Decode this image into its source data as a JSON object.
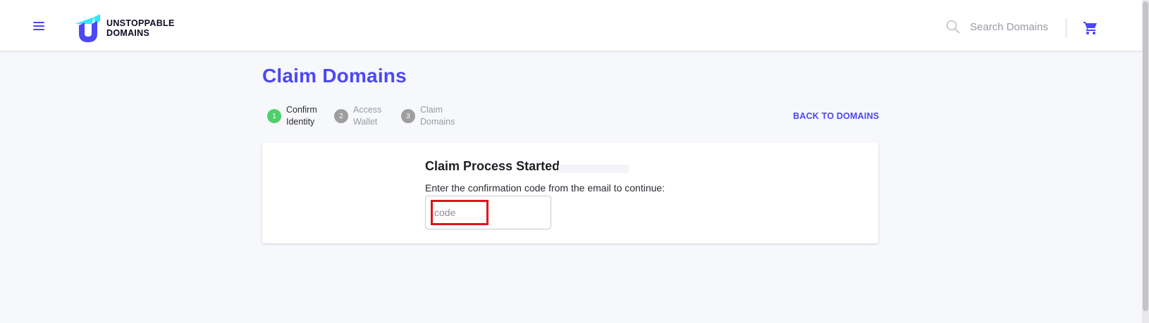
{
  "header": {
    "logo_line1": "UNSTOPPABLE",
    "logo_line2": "DOMAINS",
    "search_placeholder": "Search Domains",
    "menu_icon": "hamburger-icon",
    "search_icon": "search-icon",
    "cart_icon": "shopping-cart-icon"
  },
  "page": {
    "title": "Claim Domains",
    "back_link": "BACK TO DOMAINS"
  },
  "stepper": {
    "steps": [
      {
        "number": "1",
        "line1": "Confirm",
        "line2": "Identity",
        "state": "active",
        "color": "#4fd06b"
      },
      {
        "number": "2",
        "line1": "Access",
        "line2": "Wallet",
        "state": "inactive",
        "color": "#9e9e9e"
      },
      {
        "number": "3",
        "line1": "Claim",
        "line2": "Domains",
        "state": "inactive",
        "color": "#9e9e9e"
      }
    ]
  },
  "card": {
    "title": "Claim Process Started",
    "description": "Enter the confirmation code from the email to continue:",
    "code_placeholder": "code"
  },
  "colors": {
    "brand": "#4c47f7",
    "step_active": "#4fd06b",
    "step_inactive": "#9e9e9e",
    "highlight": "#e3121c",
    "background": "#f7f8fc"
  }
}
